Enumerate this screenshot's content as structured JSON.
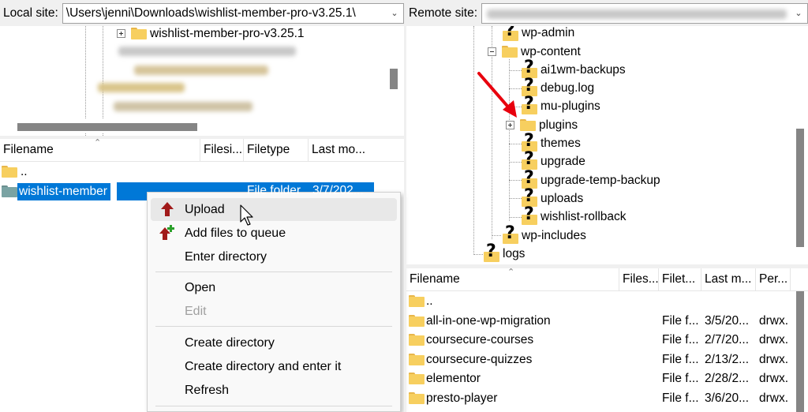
{
  "local": {
    "site_label": "Local site:",
    "path": "\\Users\\jenni\\Downloads\\wishlist-member-pro-v3.25.1\\",
    "tree": {
      "selected_folder": "wishlist-member-pro-v3.25.1"
    },
    "columns": [
      "Filename",
      "Filesi...",
      "Filetype",
      "Last mo..."
    ],
    "rows": [
      {
        "name": "..",
        "size": "",
        "type": "",
        "modified": ""
      },
      {
        "name": "wishlist-member",
        "size": "",
        "type": "File folder",
        "modified": "3/7/202..."
      }
    ]
  },
  "remote": {
    "site_label": "Remote site:",
    "tree": [
      {
        "label": "wp-admin",
        "icon": "question-folder"
      },
      {
        "label": "wp-content",
        "icon": "folder"
      },
      {
        "label": "ai1wm-backups",
        "icon": "question-folder"
      },
      {
        "label": "debug.log",
        "icon": "question-folder"
      },
      {
        "label": "mu-plugins",
        "icon": "question-folder"
      },
      {
        "label": "plugins",
        "icon": "folder"
      },
      {
        "label": "themes",
        "icon": "question-folder"
      },
      {
        "label": "upgrade",
        "icon": "question-folder"
      },
      {
        "label": "upgrade-temp-backup",
        "icon": "question-folder"
      },
      {
        "label": "uploads",
        "icon": "question-folder"
      },
      {
        "label": "wishlist-rollback",
        "icon": "question-folder"
      },
      {
        "label": "wp-includes",
        "icon": "question-folder"
      },
      {
        "label": "logs",
        "icon": "question-folder"
      }
    ],
    "columns": [
      "Filename",
      "Files...",
      "Filet...",
      "Last m...",
      "Per..."
    ],
    "rows": [
      {
        "name": "..",
        "size": "",
        "type": "",
        "modified": "",
        "perm": ""
      },
      {
        "name": "all-in-one-wp-migration",
        "size": "",
        "type": "File f...",
        "modified": "3/5/20...",
        "perm": "drwx."
      },
      {
        "name": "coursecure-courses",
        "size": "",
        "type": "File f...",
        "modified": "2/7/20...",
        "perm": "drwx."
      },
      {
        "name": "coursecure-quizzes",
        "size": "",
        "type": "File f...",
        "modified": "2/13/2...",
        "perm": "drwx."
      },
      {
        "name": "elementor",
        "size": "",
        "type": "File f...",
        "modified": "2/28/2...",
        "perm": "drwx."
      },
      {
        "name": "presto-player",
        "size": "",
        "type": "File f...",
        "modified": "3/6/20...",
        "perm": "drwx."
      }
    ]
  },
  "context_menu": {
    "items": [
      {
        "label": "Upload",
        "icon": "upload-arrow-icon",
        "enabled": true
      },
      {
        "label": "Add files to queue",
        "icon": "add-to-queue-icon",
        "enabled": true
      },
      {
        "label": "Enter directory",
        "enabled": true
      },
      {
        "label": "Open",
        "enabled": true
      },
      {
        "label": "Edit",
        "enabled": false
      },
      {
        "label": "Create directory",
        "enabled": true
      },
      {
        "label": "Create directory and enter it",
        "enabled": true
      },
      {
        "label": "Refresh",
        "enabled": true
      }
    ]
  },
  "colors": {
    "selection": "#0078d7",
    "annotation_arrow": "#e8000d",
    "folder": "#f7cf5f"
  }
}
